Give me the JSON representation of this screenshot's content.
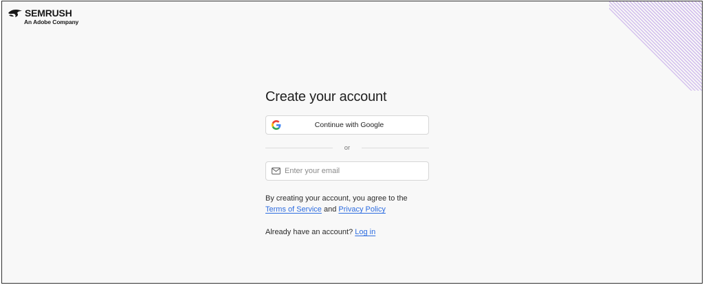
{
  "brand": {
    "name": "SEMRUSH",
    "tagline": "An Adobe Company"
  },
  "signup": {
    "title": "Create your account",
    "google_button": "Continue with Google",
    "divider_text": "or",
    "email_placeholder": "Enter your email",
    "email_value": "",
    "terms_prefix": "By creating your account, you agree to the",
    "terms_link": "Terms of Service",
    "terms_and": "and",
    "privacy_link": "Privacy Policy",
    "login_prompt": "Already have an account?",
    "login_link": "Log in"
  },
  "colors": {
    "background": "#f8f8f8",
    "link": "#2b6be0",
    "accent_purple": "#a070e0"
  },
  "icons": {
    "logo": "semrush-fire-icon",
    "google": "google-g-icon",
    "email": "envelope-icon"
  }
}
